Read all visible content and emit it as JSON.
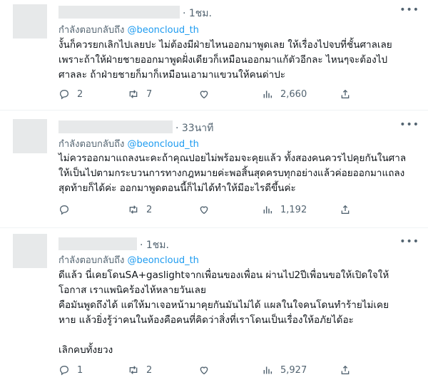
{
  "reply_prefix": "กำลังตอบกลับถึง",
  "more_icon": "more-horizontal-icon",
  "tweets": [
    {
      "time": "· 1ชม.",
      "handle": "@beoncloud_th",
      "lines": [
        "งั้นก็ควรยกเลิกไปเลยปะ ไม่ต้องมีฝ่ายไหนออกมาพูดเลย ให้เรื่องไปจบที่ชั้นศาลเลย",
        "เพราะถ้าให้ฝ่ายชายออกมาพูดฝั่งเดียวก็เหมือนออกมาแก้ตัวอีกละ ไหนๆจะต้องไป",
        "ศาลละ ถ้าฝ่ายชายก็มาก็เหมือนเอามาแขวนให้คนด่าปะ"
      ],
      "replies": "2",
      "retweets": "7",
      "likes": "",
      "views": "2,660"
    },
    {
      "time": "· 33นาที",
      "handle": "@beoncloud_th",
      "lines": [
        "ไม่ควรออกมาแถลงนะคะถ้าคุณปอยไม่พร้อมจะคุยแล้ว ทั้งสองคนควรไปคุยกันในศาล",
        "ให้เป็นไปตามกระบวนการทางกฎหมายค่ะพอสิ้นสุดครบทุกอย่างแล้วค่อยออกมาแถลง",
        "สุดท้ายก็ได้ค่ะ ออกมาพูดตอนนี้ก็ไม่ได้ทำให้มีอะไรดีขึ้นค่ะ"
      ],
      "replies": "",
      "retweets": "2",
      "likes": "",
      "views": "1,192"
    },
    {
      "time": "· 1ชม.",
      "handle": "@beoncloud_th",
      "lines": [
        "ดีแล้ว นี่เคยโดนSA+gaslightจากเพื่อนของเพื่อน ผ่านไป2ปีเพื่อนขอให้เปิดใจให้",
        "โอกาส เราแพนิคร้องไห้หลายวันเลย",
        "คือมันพูดถึงได้ แต่ให้มาเจอหน้ามาคุยกันมันไม่ได้ แผลในใจคนโดนทำร้ายไม่เคย",
        "หาย แล้วยิ่งรู้ว่าคนในห้องคือคนที่คิดว่าสิ่งที่เราโดนเป็นเรื่องให้อภัยได้อะ",
        "",
        "เลิกคบทั้งยวง"
      ],
      "replies": "1",
      "retweets": "2",
      "likes": "",
      "views": "5,927"
    }
  ]
}
